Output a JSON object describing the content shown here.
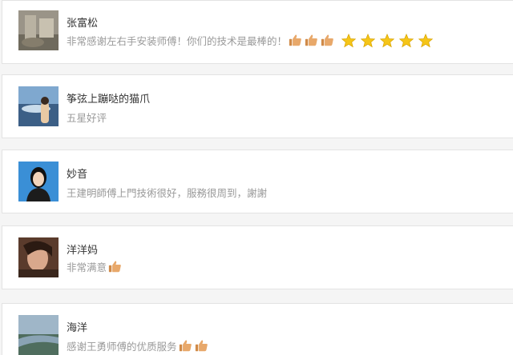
{
  "reviews": [
    {
      "name": "张富松",
      "comment": "非常感谢左右手安装师傅！你们的技术是最棒的！",
      "icons": [
        "thumbs-up-icon",
        "thumbs-up-icon",
        "thumbs-up-icon",
        "star-icon",
        "star-icon",
        "star-icon",
        "star-icon",
        "star-icon"
      ]
    },
    {
      "name": "筝弦上蹦哒的猫爪",
      "comment": "五星好评",
      "icons": []
    },
    {
      "name": "妙音",
      "comment": "王建明師傅上門技術很好，服務很周到，謝謝",
      "icons": []
    },
    {
      "name": "洋洋妈",
      "comment": "非常满意",
      "icons": [
        "thumbs-up-icon"
      ]
    },
    {
      "name": "海洋",
      "comment": "感谢王勇师傅的优质服务",
      "icons": [
        "thumbs-up-icon",
        "thumbs-up-icon"
      ]
    }
  ],
  "colors": {
    "card_background": "#ffffff",
    "card_border": "#e3e3e3",
    "page_background": "#f5f5f5",
    "name_text": "#333333",
    "comment_text": "#999999",
    "star": "#f5c518",
    "thumb": "#e8a86a"
  }
}
